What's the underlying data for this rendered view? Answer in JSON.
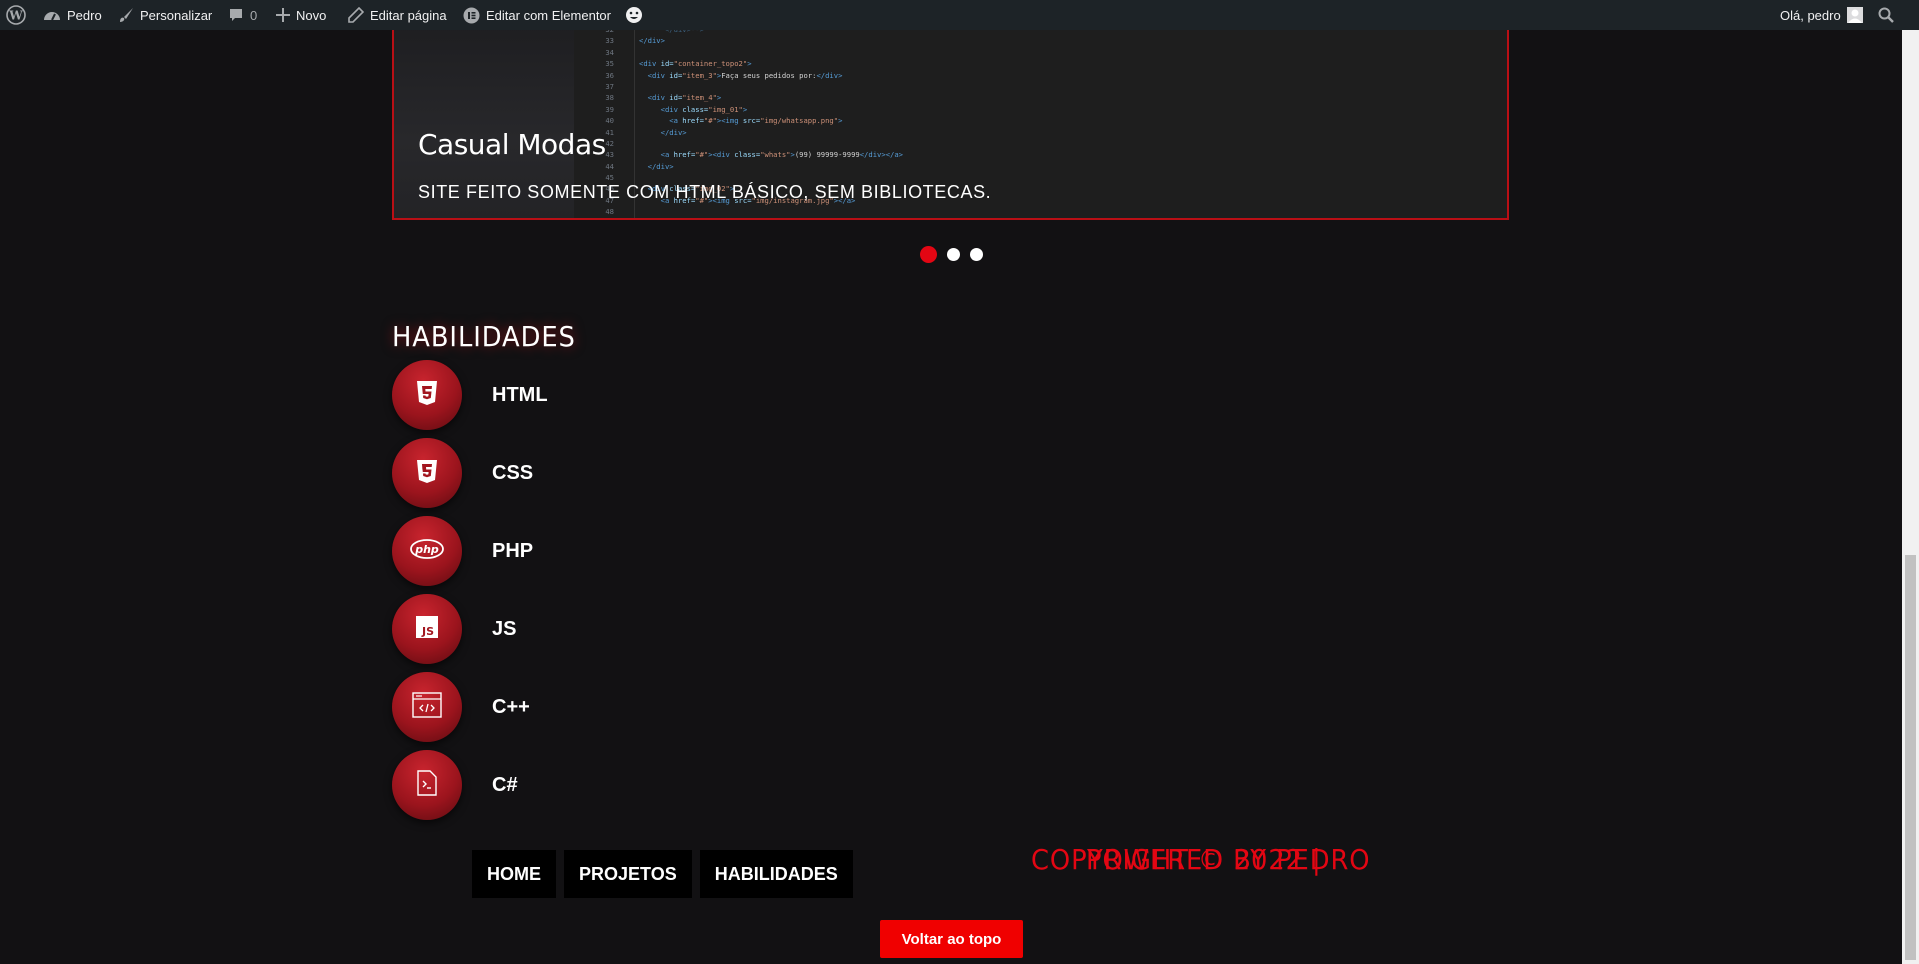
{
  "adminbar": {
    "site_name": "Pedro",
    "customize": "Personalizar",
    "comments_count": "0",
    "new": "Novo",
    "edit_page": "Editar página",
    "edit_elementor": "Editar com Elementor",
    "greeting": "Olá, pedro"
  },
  "slider": {
    "title": "Casual Modas",
    "description": "SITE FEITO SOMENTE COM HTML BÁSICO, SEM BIBLIOTECAS.",
    "code_line_numbers": [
      "32",
      "33",
      "34",
      "35",
      "36",
      "37",
      "38",
      "39",
      "40",
      "41",
      "42",
      "43",
      "44",
      "45",
      "46",
      "47",
      "48"
    ],
    "active_slide": 1,
    "slide_count": 3
  },
  "skills": {
    "heading": "HABILIDADES",
    "items": [
      {
        "label": "HTML",
        "icon": "html5-icon"
      },
      {
        "label": "CSS",
        "icon": "css3-icon"
      },
      {
        "label": "PHP",
        "icon": "php-icon"
      },
      {
        "label": "JS",
        "icon": "js-icon"
      },
      {
        "label": "C++",
        "icon": "code-window-icon"
      },
      {
        "label": "C#",
        "icon": "code-file-icon"
      }
    ]
  },
  "footer": {
    "nav": [
      "HOME",
      "PROJETOS",
      "HABILIDADES"
    ],
    "copyright": "COPYRIGHT © 2022 |",
    "powered": "POWERED BY PEDRO",
    "back_to_top": "Voltar ao topo"
  },
  "colors": {
    "accent": "#e30613",
    "badge": "#9b141d",
    "background": "#121113",
    "adminbar": "#1d2327"
  }
}
